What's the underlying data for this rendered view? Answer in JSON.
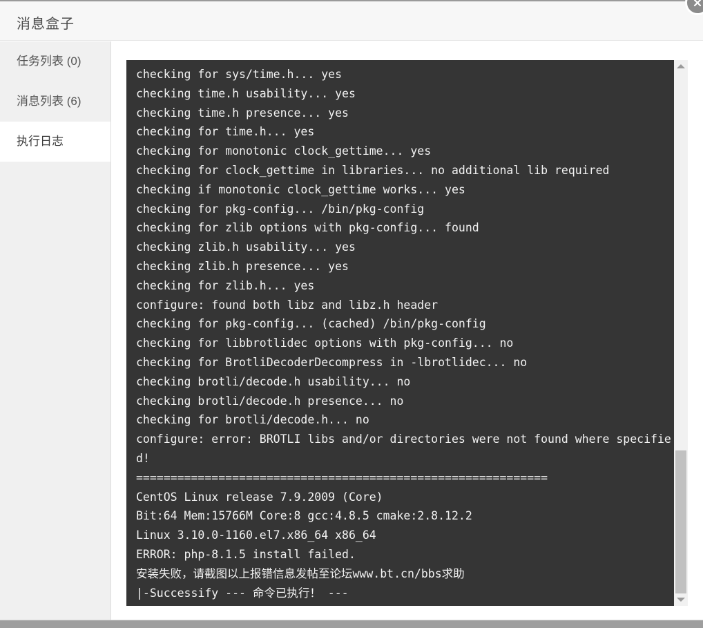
{
  "window": {
    "title": "消息盒子",
    "close_icon": "close-circle-icon"
  },
  "sidebar": {
    "items": [
      {
        "label": "任务列表 (0)",
        "name": "task-list",
        "active": false
      },
      {
        "label": "消息列表 (6)",
        "name": "message-list",
        "active": false
      },
      {
        "label": "执行日志",
        "name": "execution-log",
        "active": true
      }
    ]
  },
  "log": {
    "lines": [
      "checking for sys/time.h... yes",
      "checking time.h usability... yes",
      "checking time.h presence... yes",
      "checking for time.h... yes",
      "checking for monotonic clock_gettime... yes",
      "checking for clock_gettime in libraries... no additional lib required",
      "checking if monotonic clock_gettime works... yes",
      "checking for pkg-config... /bin/pkg-config",
      "checking for zlib options with pkg-config... found",
      "checking zlib.h usability... yes",
      "checking zlib.h presence... yes",
      "checking for zlib.h... yes",
      "configure: found both libz and libz.h header",
      "checking for pkg-config... (cached) /bin/pkg-config",
      "checking for libbrotlidec options with pkg-config... no",
      "checking for BrotliDecoderDecompress in -lbrotlidec... no",
      "checking brotli/decode.h usability... no",
      "checking brotli/decode.h presence... no",
      "checking for brotli/decode.h... no",
      "configure: error: BROTLI libs and/or directories were not found where specified!",
      "============================================================",
      "CentOS Linux release 7.9.2009 (Core)",
      "Bit:64 Mem:15766M Core:8 gcc:4.8.5 cmake:2.8.12.2",
      "Linux 3.10.0-1160.el7.x86_64 x86_64",
      "ERROR: php-8.1.5 install failed.",
      "安装失败，请截图以上报错信息发帖至论坛www.bt.cn/bbs求助",
      "|-Successify --- 命令已执行！ ---"
    ]
  },
  "scrollbar": {
    "up_arrow_icon": "chevron-up-icon",
    "down_arrow_icon": "chevron-down-icon"
  },
  "colors": {
    "terminal_background": "#353535",
    "terminal_text": "#f2f2f2",
    "sidebar_background": "#f0f0f0",
    "header_background": "#f7f7f7",
    "close_button": "#8c8c8c"
  }
}
